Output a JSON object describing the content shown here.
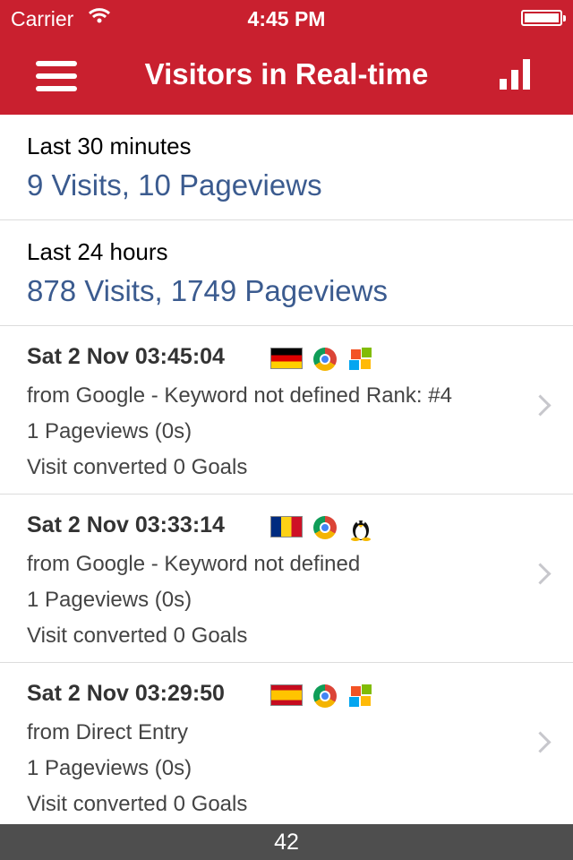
{
  "status_bar": {
    "carrier": "Carrier",
    "time": "4:45 PM"
  },
  "header": {
    "title": "Visitors in Real-time",
    "menu_icon": "hamburger-icon",
    "stats_icon": "bar-chart-icon"
  },
  "summaries": [
    {
      "label": "Last 30 minutes",
      "value": "9 Visits, 10 Pageviews"
    },
    {
      "label": "Last 24 hours",
      "value": "878 Visits, 1749 Pageviews"
    }
  ],
  "visits": [
    {
      "date": "Sat 2 Nov 03:45:04",
      "referrer": "from Google - Keyword not defined Rank: #4",
      "pageviews": "1 Pageviews (0s)",
      "goals": "Visit converted 0 Goals",
      "flag": "germany-flag-icon",
      "browser": "chrome-icon",
      "os": "windows-icon"
    },
    {
      "date": "Sat 2 Nov 03:33:14",
      "referrer": "from Google - Keyword not defined",
      "pageviews": "1 Pageviews (0s)",
      "goals": "Visit converted 0 Goals",
      "flag": "romania-flag-icon",
      "browser": "chrome-icon",
      "os": "linux-icon"
    },
    {
      "date": "Sat 2 Nov 03:29:50",
      "referrer": "from Direct Entry",
      "pageviews": "1 Pageviews (0s)",
      "goals": "Visit converted 0 Goals",
      "flag": "spain-flag-icon",
      "browser": "chrome-icon",
      "os": "windows-icon"
    }
  ],
  "footer": {
    "count": "42"
  },
  "colors": {
    "header_bg": "#c9202f",
    "value_text": "#3b5b8f",
    "footer_bg": "#4e4e4e"
  }
}
